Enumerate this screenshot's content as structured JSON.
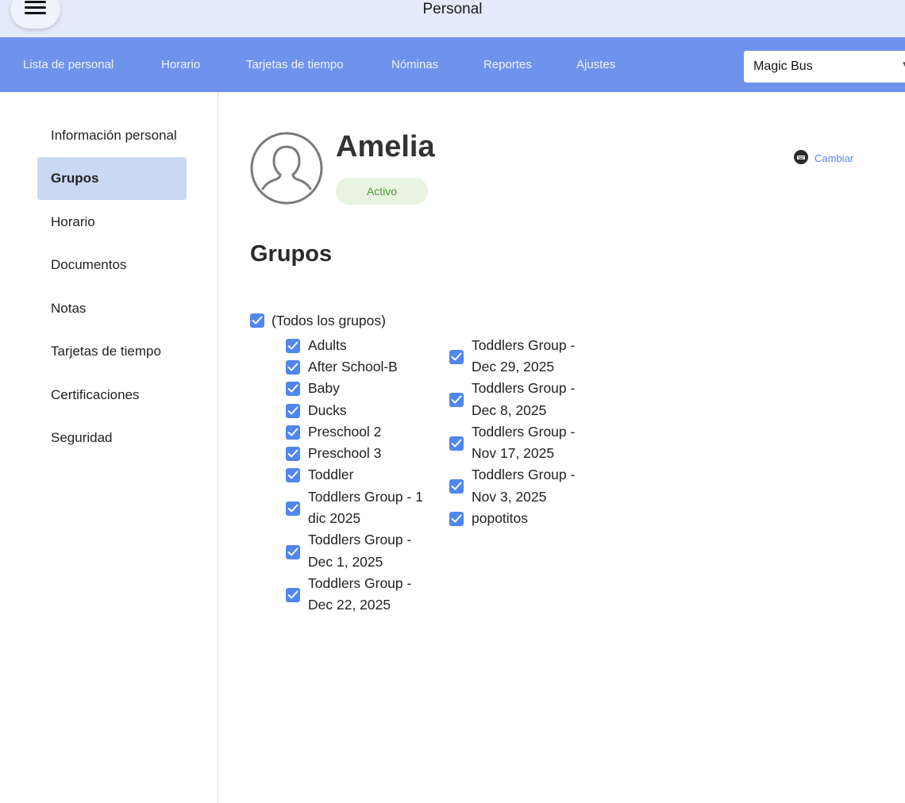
{
  "app": {
    "title": "Personal"
  },
  "nav": {
    "items": [
      {
        "label": "Lista de personal"
      },
      {
        "label": "Horario"
      },
      {
        "label": "Tarjetas de tiempo"
      },
      {
        "label": "Nóminas"
      },
      {
        "label": "Reportes"
      },
      {
        "label": "Ajustes"
      }
    ],
    "site_select": {
      "value": "Magic Bus"
    }
  },
  "sidebar": {
    "items": [
      {
        "label": "Información personal"
      },
      {
        "label": "Grupos",
        "active": true
      },
      {
        "label": "Horario"
      },
      {
        "label": "Documentos"
      },
      {
        "label": "Notas"
      },
      {
        "label": "Tarjetas de tiempo"
      },
      {
        "label": "Certificaciones"
      },
      {
        "label": "Seguridad"
      }
    ]
  },
  "profile": {
    "name": "Amelia",
    "status": "Activo",
    "change_label": "Cambiar"
  },
  "groups": {
    "title": "Grupos",
    "all_label": "(Todos los grupos)",
    "all_checked": true,
    "column1": [
      {
        "line1": "Adults",
        "line2": "",
        "checked": true
      },
      {
        "line1": "After School-B",
        "line2": "",
        "checked": true
      },
      {
        "line1": "Baby",
        "line2": "",
        "checked": true
      },
      {
        "line1": "Ducks",
        "line2": "",
        "checked": true
      },
      {
        "line1": "Preschool 2",
        "line2": "",
        "checked": true
      },
      {
        "line1": "Preschool 3",
        "line2": "",
        "checked": true
      },
      {
        "line1": "Toddler",
        "line2": "",
        "checked": true
      },
      {
        "line1": "Toddlers Group - 1",
        "line2": "dic 2025",
        "checked": true
      },
      {
        "line1": "Toddlers Group -",
        "line2": "Dec 1, 2025",
        "checked": true
      },
      {
        "line1": "Toddlers Group -",
        "line2": "Dec 22, 2025",
        "checked": true
      }
    ],
    "column2": [
      {
        "line1": "Toddlers Group -",
        "line2": "Dec 29, 2025",
        "checked": true
      },
      {
        "line1": "Toddlers Group -",
        "line2": "Dec 8, 2025",
        "checked": true
      },
      {
        "line1": "Toddlers Group -",
        "line2": "Nov 17, 2025",
        "checked": true
      },
      {
        "line1": "Toddlers Group -",
        "line2": "Nov 3, 2025",
        "checked": true
      },
      {
        "line1": "popotitos",
        "line2": "",
        "checked": true
      }
    ]
  },
  "colors": {
    "titlebar": "#e3ebfb",
    "navbar": "#6f93ec",
    "active_sidebar": "#cad8f4",
    "checkbox": "#4f86f0",
    "status_text": "#4d9a3a",
    "link": "#5b84e6"
  },
  "icons": {
    "menu": "hamburger-icon",
    "avatar": "user-outline-icon",
    "change": "keyboard-icon",
    "dropdown": "chevron-down-icon"
  }
}
